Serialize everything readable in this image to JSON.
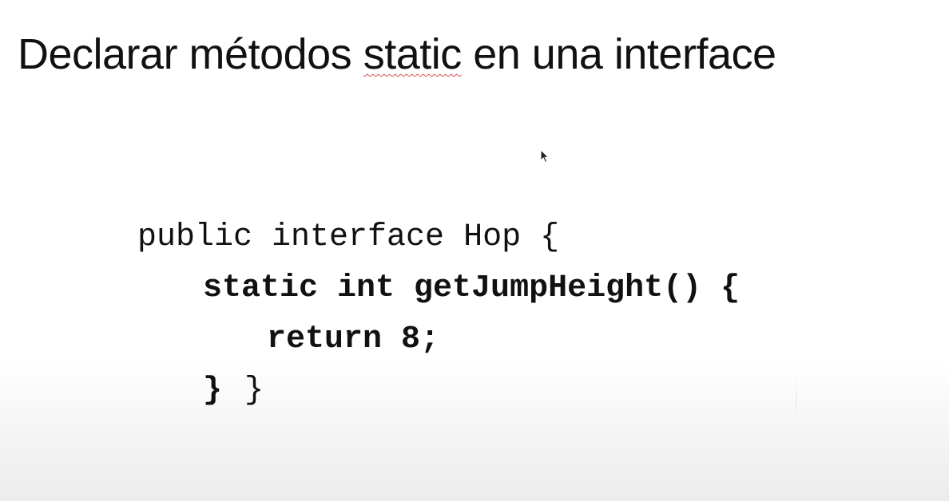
{
  "slide": {
    "title_before": "Declarar métodos ",
    "title_keyword": "static",
    "title_after": " en una interface"
  },
  "code": {
    "line1": "public interface Hop {",
    "line2": "static int getJumpHeight() {",
    "line3": "return 8;",
    "line4_brace_inner": "}",
    "line4_brace_outer": "}"
  },
  "icons": {
    "cursor": "mouse-pointer-icon"
  },
  "colors": {
    "text": "#111111",
    "spellcheck_underline": "#d9534f",
    "background": "#ffffff"
  }
}
